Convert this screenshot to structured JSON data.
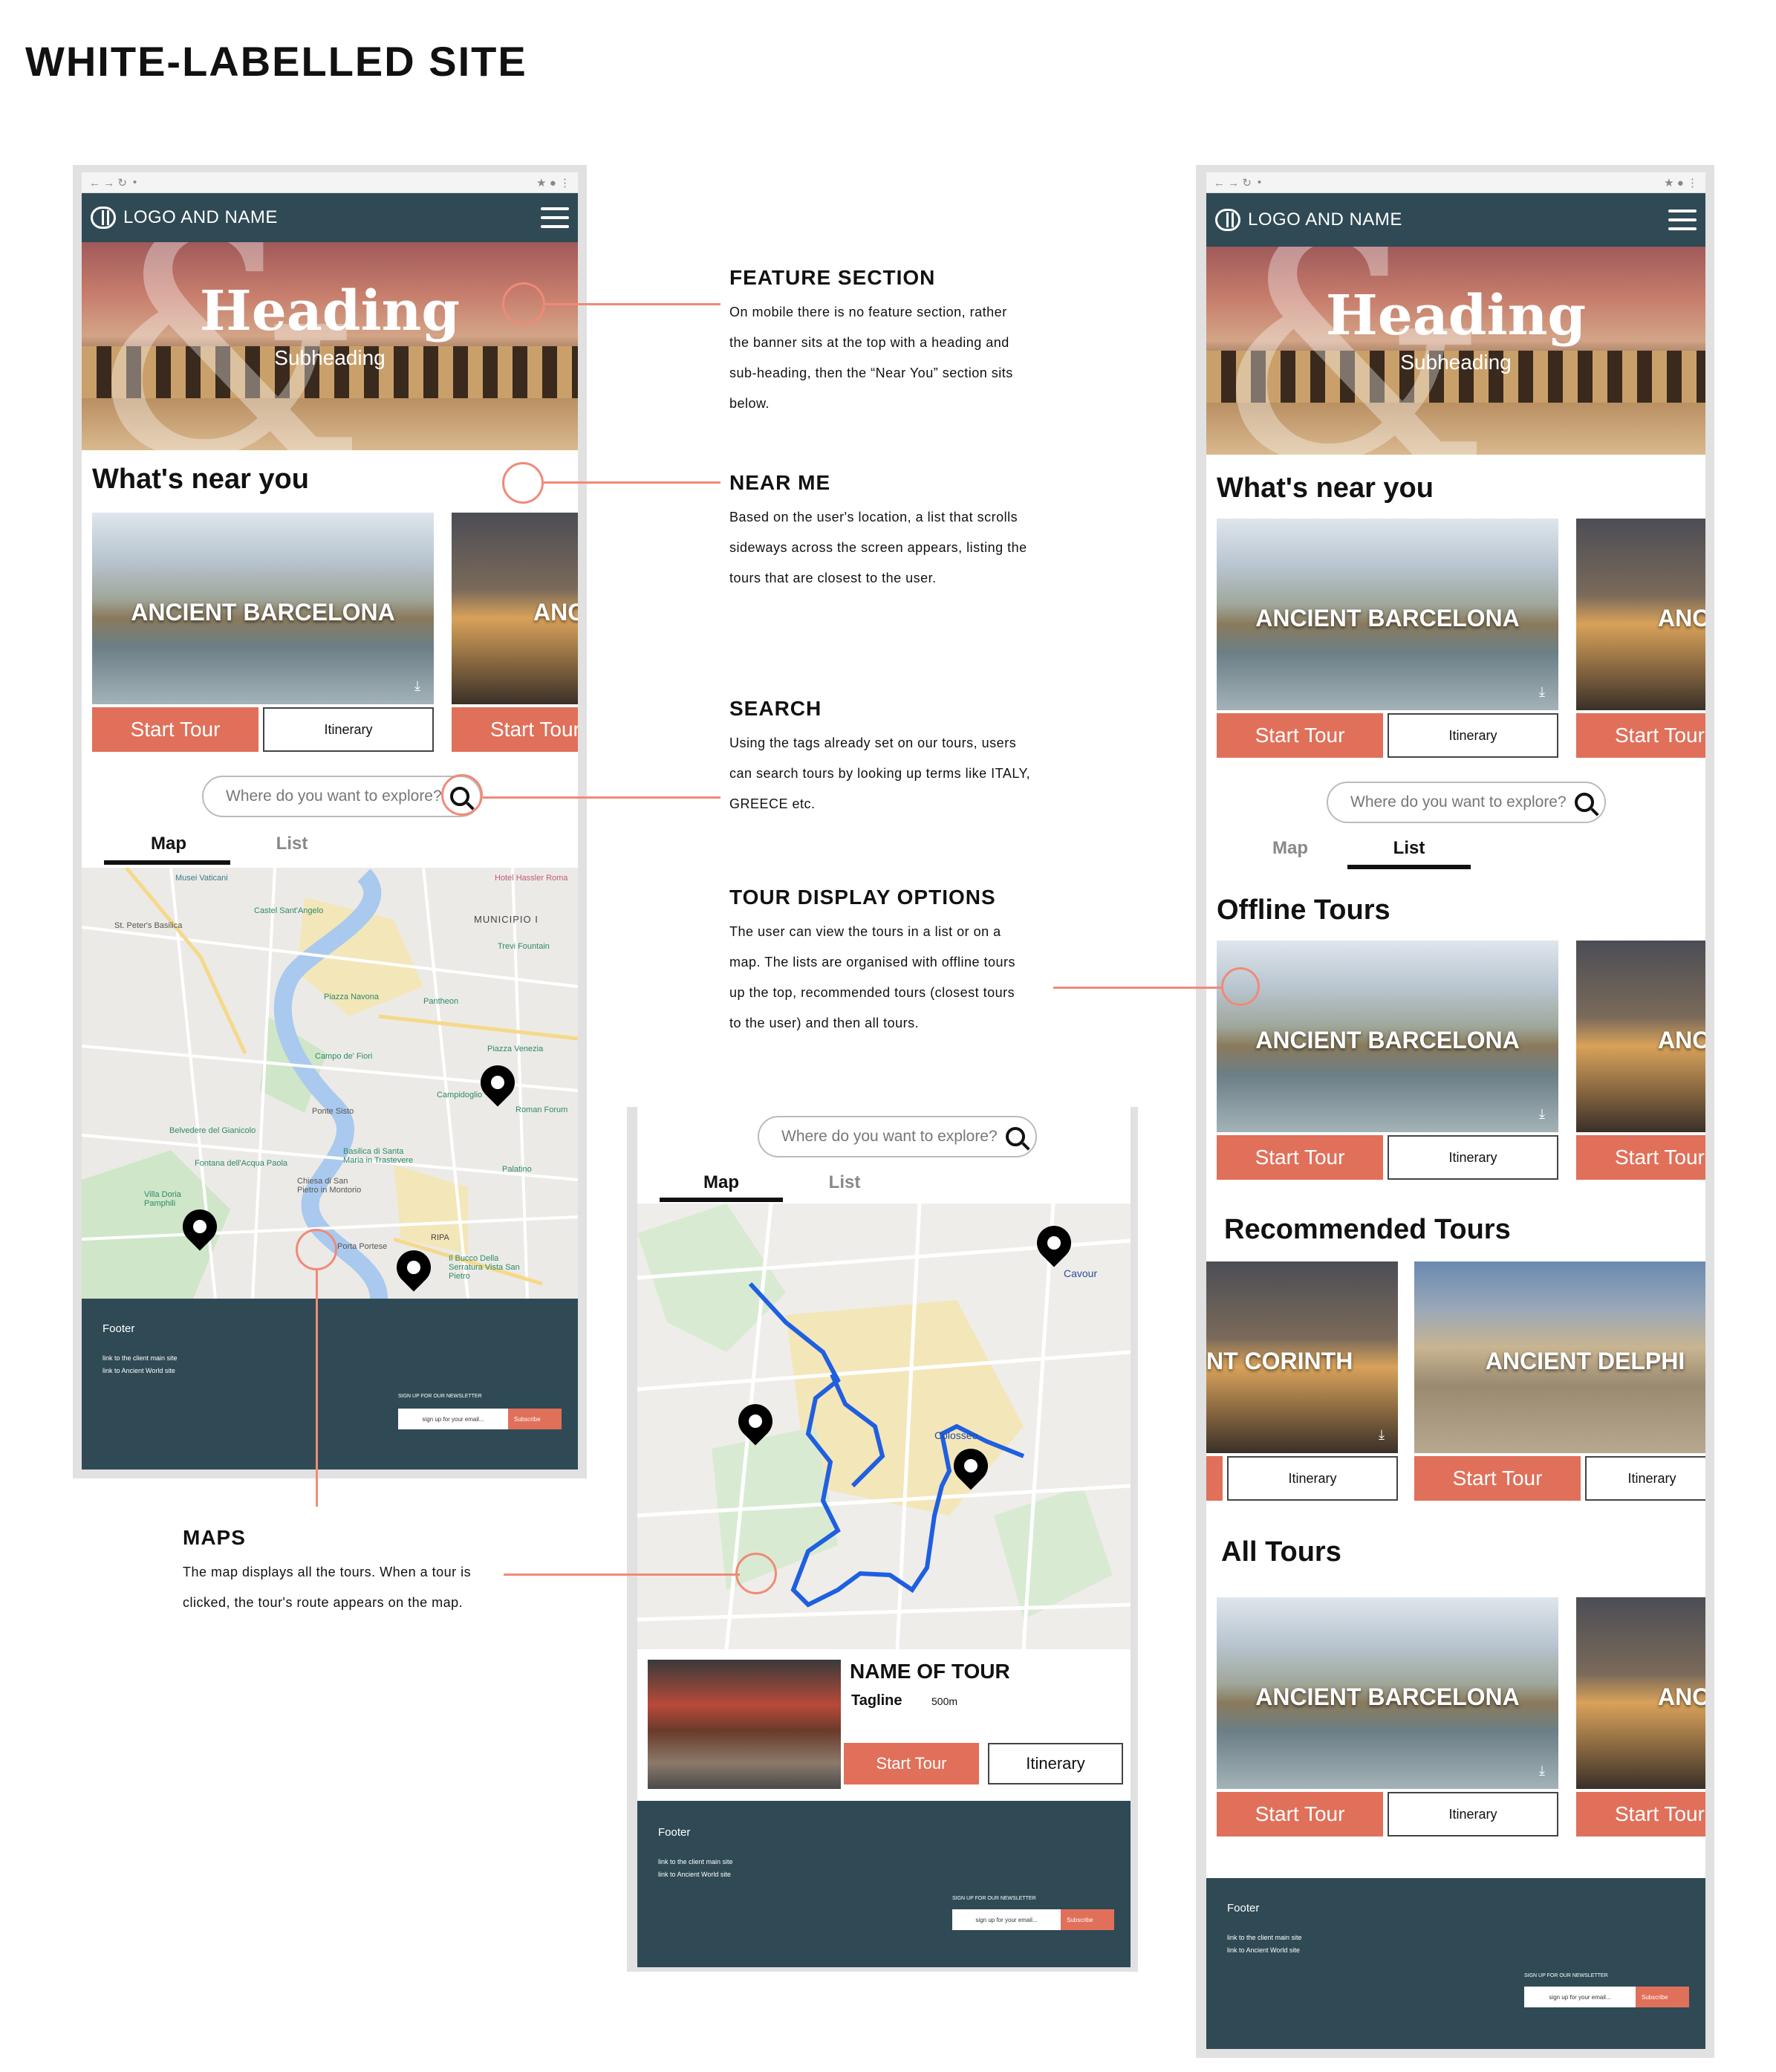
{
  "page_title": "WHITE-LABELLED SITE",
  "chrome": {
    "nav": "← → ↻",
    "lock": "•",
    "right": "★ ● ⋮"
  },
  "navbar": {
    "logo_name": "LOGO AND NAME"
  },
  "banner": {
    "heading": "Heading",
    "subheading": "Subheading"
  },
  "sections": {
    "near_you": "What's near you",
    "offline": "Offline Tours",
    "recommended": "Recommended Tours",
    "all": "All Tours"
  },
  "tours": {
    "barcelona": "ANCIENT BARCELONA",
    "anc_partial": "ANC",
    "corinth_partial": "NT CORINTH",
    "delphi": "ANCIENT DELPHI"
  },
  "buttons": {
    "start_tour": "Start Tour",
    "start_tour_cut": "Start Tour",
    "itinerary": "Itinerary"
  },
  "search": {
    "placeholder": "Where do you want to explore?"
  },
  "tabs": {
    "map": "Map",
    "list": "List"
  },
  "tour_card": {
    "name": "NAME OF TOUR",
    "tagline": "Tagline",
    "distance": "500m"
  },
  "footer": {
    "title": "Footer",
    "link1": "link to the client main site",
    "link2": "link to Ancient World site",
    "newsletter": "SIGN UP FOR OUR NEWSLETTER",
    "email_placeholder": "sign up for your email...",
    "subscribe": "Subscribe"
  },
  "map_labels": {
    "musei": "Musei Vaticani",
    "hotel": "Hotel Hassler Roma",
    "municipio": "MUNICIPIO I",
    "castel": "Castel Sant'Angelo",
    "peters": "St. Peter's Basilica",
    "trevi": "Trevi Fountain",
    "navona": "Piazza Navona",
    "pantheon": "Pantheon",
    "fiori": "Campo de' Fiori",
    "venezia": "Piazza Venezia",
    "campidoglio": "Campidoglio",
    "forum": "Roman Forum",
    "sisto": "Ponte Sisto",
    "gianicolo": "Belvedere del Gianicolo",
    "trastevere": "Basilica di Santa Maria in Trastevere",
    "paola": "Fontana dell'Acqua Paola",
    "montorio": "Chiesa di San Pietro in Montorio",
    "palatino": "Palatino",
    "pamphili": "Villa Doria Pamphili",
    "portese": "Porta Portese",
    "ripa": "RIPA",
    "bucco": "Il Bucco Della Serratura Vista San Pietro",
    "cavour": "Cavour",
    "colosseo": "Colosseo"
  },
  "annotations": {
    "feature": {
      "title": "FEATURE SECTION",
      "body": [
        "On mobile there is no feature section, rather",
        "the banner sits at the top with a heading and",
        "sub-heading, then the “Near You” section sits",
        "below."
      ]
    },
    "near": {
      "title": "NEAR ME",
      "body": [
        "Based on the user's location, a list that scrolls",
        "sideways across the screen appears, listing the",
        "tours that are closest to the user."
      ]
    },
    "search": {
      "title": "SEARCH",
      "body": [
        "Using the tags already set on our tours, users",
        "can search tours by looking up terms like ITALY,",
        "GREECE etc."
      ]
    },
    "display": {
      "title": "TOUR DISPLAY OPTIONS",
      "body": [
        "The user can view the tours in a list or on a",
        "map. The lists are organised with offline tours",
        "up the top, recommended tours (closest tours",
        "to the user) and then all tours."
      ]
    },
    "maps": {
      "title": "MAPS",
      "body": [
        "The map displays all the tours. When a tour is",
        "clicked, the tour's route appears on the map."
      ]
    }
  },
  "colors": {
    "accent": "#e0705a",
    "nav": "#2f4a55",
    "annotation": "#f08a78",
    "river": "#a9c9ef",
    "route": "#1f5fe0"
  }
}
